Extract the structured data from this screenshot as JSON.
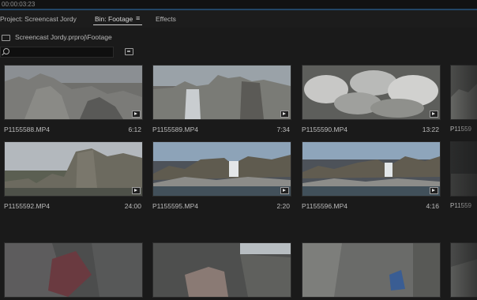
{
  "app": {
    "timecode": "00:00:03:23"
  },
  "tabs": [
    {
      "label": "Project: Screencast Jordy"
    },
    {
      "label": "Bin: Footage"
    },
    {
      "label": "Effects"
    }
  ],
  "path": {
    "text": "Screencast Jordy.prproj\\Footage"
  },
  "search": {
    "value": "",
    "placeholder": ""
  },
  "clips": [
    {
      "name": "P1155588.MP4",
      "duration": "6:12"
    },
    {
      "name": "P1155589.MP4",
      "duration": "7:34"
    },
    {
      "name": "P1155590.MP4",
      "duration": "13:22"
    },
    {
      "name": "P11559",
      "duration": ""
    },
    {
      "name": "P1155592.MP4",
      "duration": "24:00"
    },
    {
      "name": "P1155595.MP4",
      "duration": "2:20"
    },
    {
      "name": "P1155596.MP4",
      "duration": "4:16"
    },
    {
      "name": "P11559",
      "duration": ""
    },
    {
      "name": "",
      "duration": ""
    },
    {
      "name": "",
      "duration": ""
    },
    {
      "name": "",
      "duration": ""
    },
    {
      "name": "",
      "duration": ""
    }
  ],
  "icons": {
    "folder": "folder-icon",
    "search": "search-icon",
    "new_bin": "new-bin-icon",
    "menu": "hamburger-menu-icon",
    "clip_badge": "video-clip-icon"
  },
  "colors": {
    "background": "#1a1a1a",
    "accent": "#2e6ea8"
  }
}
